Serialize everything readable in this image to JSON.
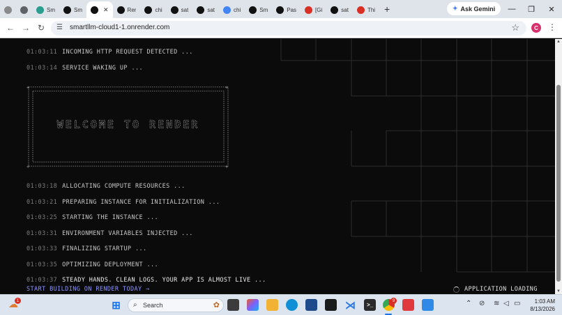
{
  "browser": {
    "tabs": [
      {
        "label": "",
        "icon": "globe-icon",
        "color": "#8a8a8a"
      },
      {
        "label": "",
        "icon": "settings-icon",
        "color": "#5f6368"
      },
      {
        "label": "Sm",
        "icon": "smartllm-icon",
        "color": "#2a9d8f"
      },
      {
        "label": "Sm",
        "icon": "render-icon",
        "color": "#111111"
      },
      {
        "label": "",
        "icon": "render-icon",
        "color": "#111111",
        "active": true
      },
      {
        "label": "Rer",
        "icon": "render-icon",
        "color": "#111111"
      },
      {
        "label": "chi",
        "icon": "openai-icon",
        "color": "#111111"
      },
      {
        "label": "sat",
        "icon": "github-icon",
        "color": "#111111"
      },
      {
        "label": "sat",
        "icon": "github-icon",
        "color": "#111111"
      },
      {
        "label": "chi",
        "icon": "google-icon",
        "color": "#4285f4"
      },
      {
        "label": "Sm",
        "icon": "render-icon",
        "color": "#111111"
      },
      {
        "label": "Pas",
        "icon": "github-icon",
        "color": "#111111"
      },
      {
        "label": "[Gi",
        "icon": "gmail-icon",
        "color": "#d93025"
      },
      {
        "label": "sat",
        "icon": "github-icon",
        "color": "#111111"
      },
      {
        "label": "Thi",
        "icon": "youtube-icon",
        "color": "#d93025"
      }
    ],
    "new_tab_label": "+",
    "gemini_label": "Ask Gemini",
    "url": "smartllm-cloud1-1.onrender.com",
    "profile_initial": "C"
  },
  "console": {
    "logs_top": [
      {
        "time": "01:03:11",
        "text": "INCOMING HTTP REQUEST DETECTED ..."
      },
      {
        "time": "01:03:14",
        "text": "SERVICE WAKING UP ..."
      }
    ],
    "banner_text": "WELCOME TO RENDER",
    "logs_bottom": [
      {
        "time": "01:03:18",
        "text": "ALLOCATING COMPUTE RESOURCES ..."
      },
      {
        "time": "01:03:21",
        "text": "PREPARING INSTANCE FOR INITIALIZATION ..."
      },
      {
        "time": "01:03:25",
        "text": "STARTING THE INSTANCE ..."
      },
      {
        "time": "01:03:31",
        "text": "ENVIRONMENT VARIABLES INJECTED ..."
      },
      {
        "time": "01:03:33",
        "text": "FINALIZING STARTUP ..."
      },
      {
        "time": "01:03:35",
        "text": "OPTIMIZING DEPLOYMENT ..."
      },
      {
        "time": "01:03:37",
        "text": "STEADY HANDS. CLEAN LOGS. YOUR APP IS ALMOST LIVE ..."
      }
    ],
    "cta": "START BUILDING ON RENDER TODAY →",
    "loading": "APPLICATION LOADING"
  },
  "taskbar": {
    "weather_badge": "1",
    "search_label": "Search",
    "chrome_badge": "9",
    "time": "1:03 AM",
    "date": "8/13/2026"
  },
  "colors": {
    "background": "#0b0b0b",
    "cta": "#8f95ff",
    "grid": "#2c2c2c"
  }
}
